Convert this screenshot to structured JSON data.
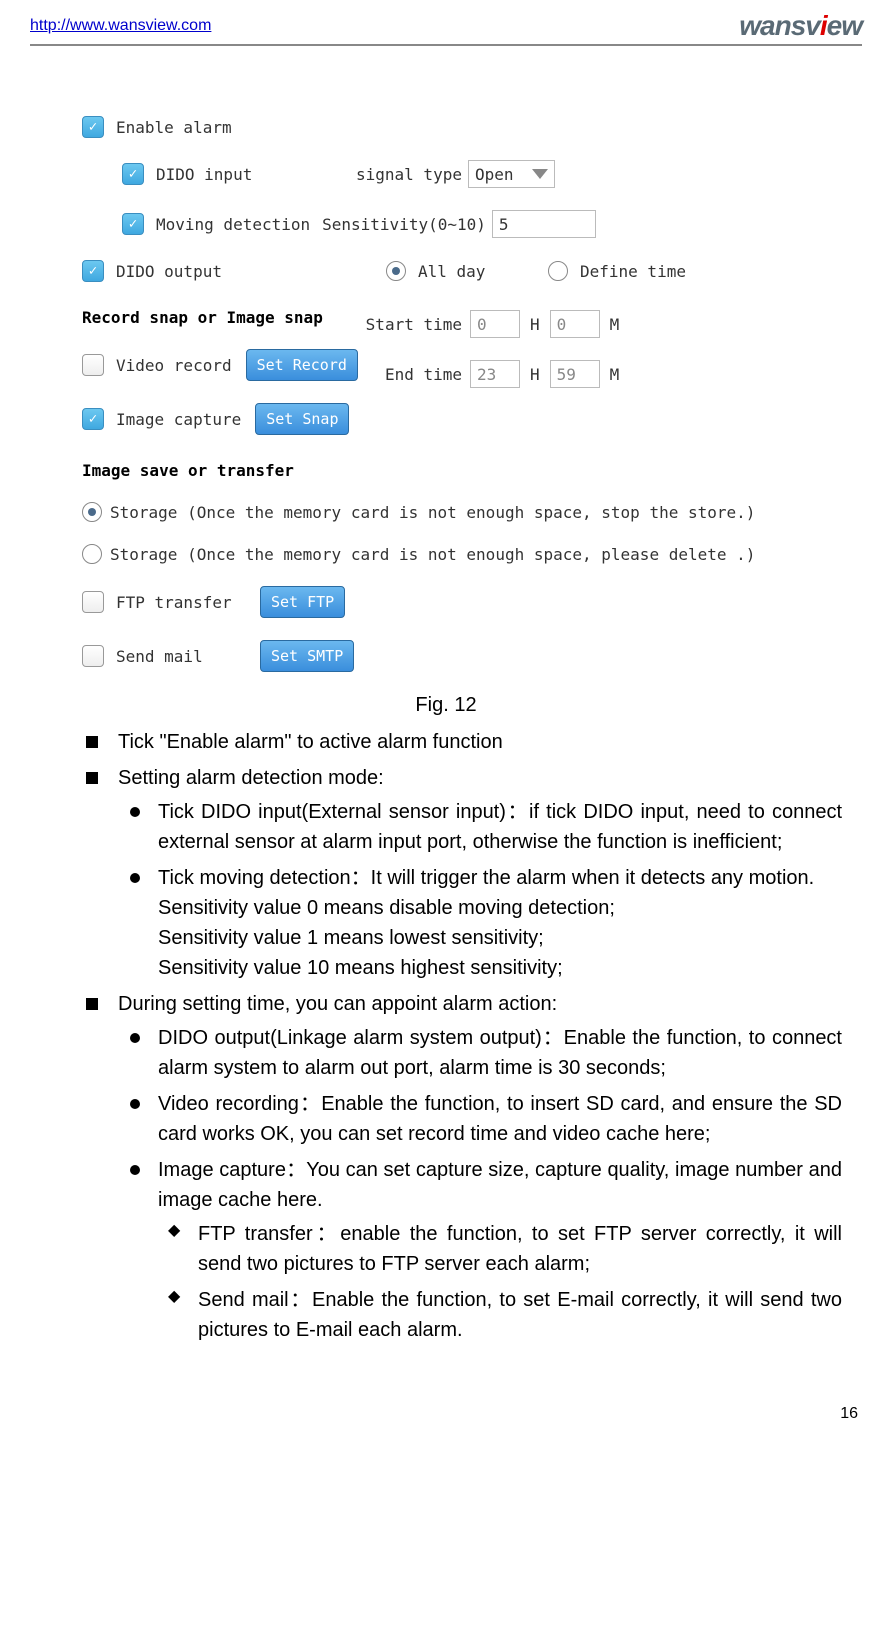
{
  "header": {
    "url": "http://www.wansview.com",
    "logo": "wansview"
  },
  "screenshot": {
    "enable_alarm": "Enable alarm",
    "dido_input": "DIDO input",
    "signal_type_label": "signal type",
    "signal_type_value": "Open",
    "moving_detection": "Moving detection",
    "sensitivity_label": "Sensitivity(0~10)",
    "sensitivity_value": "5",
    "dido_output": "DIDO output",
    "all_day": "All day",
    "define_time": "Define time",
    "section_record": "Record snap or Image snap",
    "start_time": "Start time",
    "start_h": "0",
    "start_m": "0",
    "end_time": "End time",
    "end_h": "23",
    "end_m": "59",
    "h": "H",
    "m": "M",
    "video_record": "Video record",
    "set_record": "Set Record",
    "image_capture": "Image capture",
    "set_snap": "Set Snap",
    "section_save": "Image save or transfer",
    "storage_stop": "Storage (Once the memory card is not enough space, stop the store.)",
    "storage_delete": "Storage (Once the memory card is not enough space, please delete .)",
    "ftp_transfer": "FTP transfer",
    "set_ftp": "Set FTP",
    "send_mail": "Send mail",
    "set_smtp": "Set SMTP"
  },
  "caption": "Fig. 12",
  "bullets": {
    "b1": "Tick \"Enable alarm\" to active alarm function",
    "b2": "Setting alarm detection mode:",
    "b2_1": "Tick DIDO input(External sensor input)：if tick DIDO input, need to connect external sensor at alarm input port, otherwise the function is inefficient;",
    "b2_2": "Tick moving detection：It will trigger the alarm when it detects any motion.",
    "b2_2a": "Sensitivity value 0 means disable moving detection;",
    "b2_2b": "Sensitivity value 1 means lowest sensitivity;",
    "b2_2c": "Sensitivity value 10 means highest sensitivity;",
    "b3": "During setting time, you can appoint alarm action:",
    "b3_1": "DIDO output(Linkage alarm system output)：Enable the function, to connect alarm system to alarm out port, alarm time is 30 seconds;",
    "b3_2": "Video recording：Enable the function, to insert SD card, and ensure the SD card works OK, you can set record time and video cache here;",
    "b3_3": "Image capture：You can set capture size, capture quality, image number and image cache here.",
    "b3_3a": "FTP transfer：enable the function, to set FTP server correctly, it will send two pictures to FTP server each alarm;",
    "b3_3b": "Send mail：Enable the function, to set E-mail correctly, it will send two pictures to E-mail each alarm."
  },
  "page_number": "16"
}
